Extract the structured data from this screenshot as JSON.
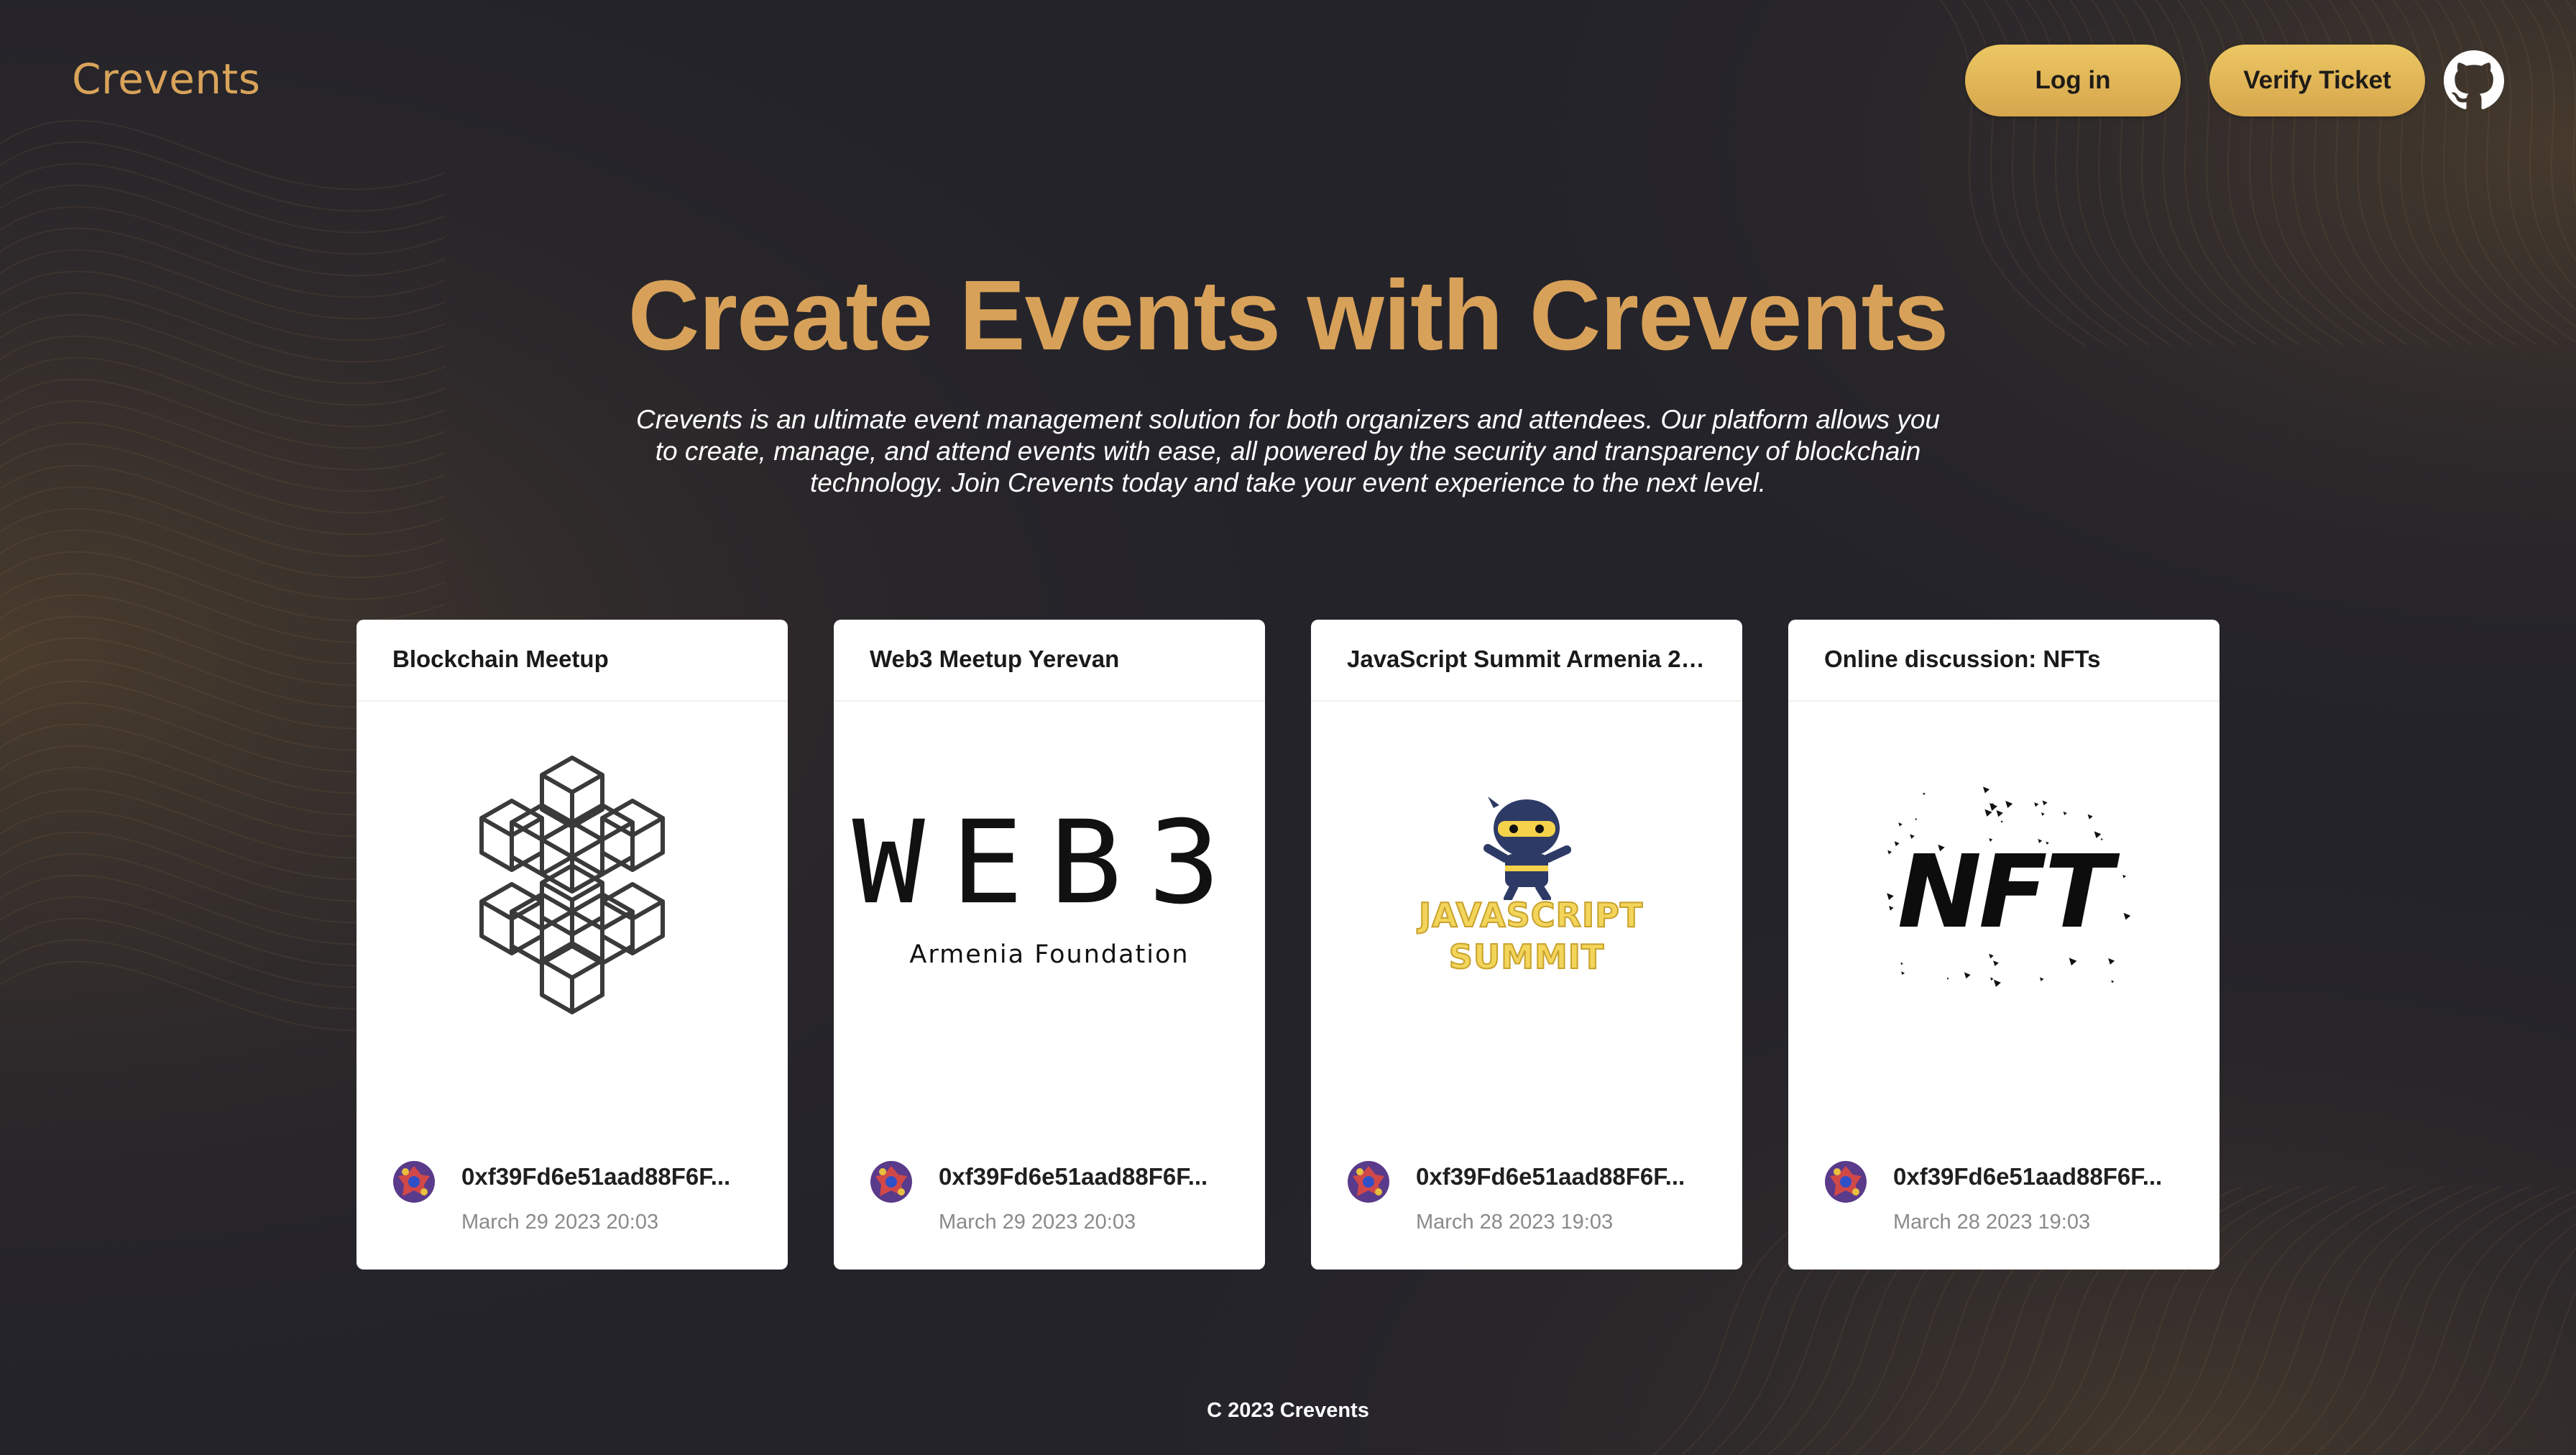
{
  "app": {
    "brand": "Crevents",
    "accent": "#d9a35a",
    "background": "#24232a"
  },
  "header": {
    "login_label": "Log in",
    "verify_label": "Verify Ticket",
    "github_icon": "github-icon"
  },
  "hero": {
    "title": "Create Events with Crevents",
    "description": "Crevents is an ultimate event management solution for both organizers and attendees. Our platform allows you to create, manage, and attend events with ease, all powered by the security and transparency of blockchain technology. Join Crevents today and take your event experience to the next level."
  },
  "events": [
    {
      "title": "Blockchain Meetup",
      "owner": "0xf39Fd6e51aad88F6F...",
      "date": "March 29 2023 20:03",
      "image": "hexagon-cubes-icon"
    },
    {
      "title": "Web3 Meetup Yerevan",
      "owner": "0xf39Fd6e51aad88F6F...",
      "date": "March 29 2023 20:03",
      "image": "web3-logo",
      "image_text": {
        "line1": "WEB3",
        "line2": "Armenia Foundation"
      }
    },
    {
      "title": "JavaScript Summit Armenia 20...",
      "owner": "0xf39Fd6e51aad88F6F...",
      "date": "March 28 2023 19:03",
      "image": "javascript-summit-ninja-logo",
      "image_text": {
        "line1": "JAVASCRIPT",
        "line2": "SUMMIT"
      }
    },
    {
      "title": "Online discussion: NFTs",
      "owner": "0xf39Fd6e51aad88F6F...",
      "date": "March 28 2023 19:03",
      "image": "nft-logo",
      "image_text": {
        "line1": "NFT"
      }
    }
  ],
  "footer": {
    "text": "C 2023 Crevents"
  }
}
